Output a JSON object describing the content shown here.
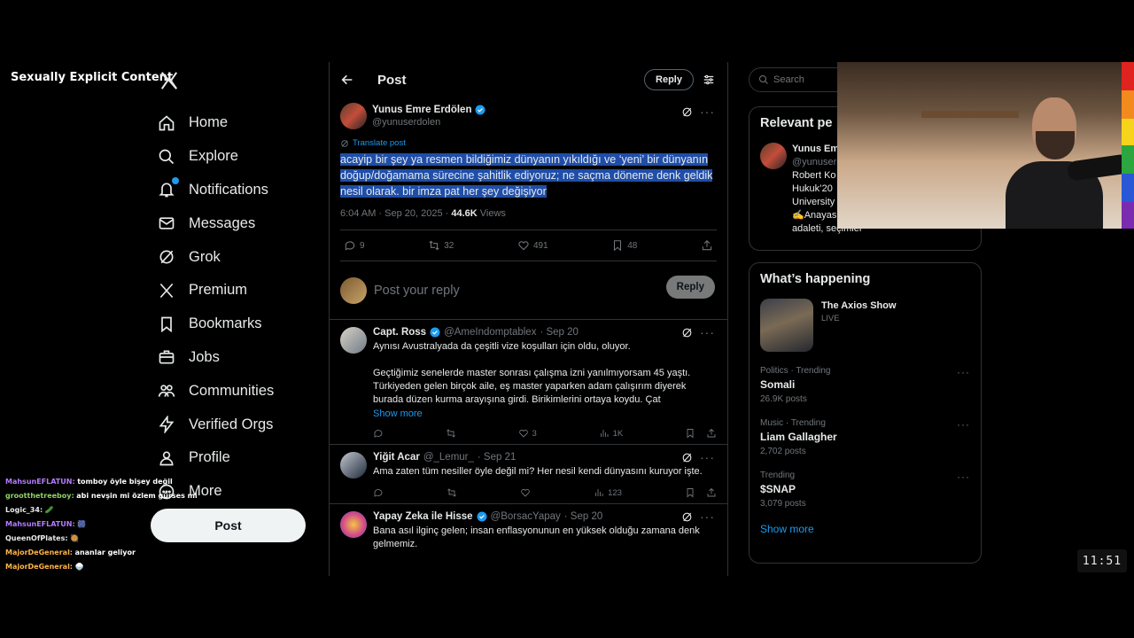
{
  "overlay": {
    "nsfw_label": "Sexually Explicit Content",
    "clock": "11:51"
  },
  "nav": {
    "items": [
      {
        "label": "Home",
        "icon": "home-icon"
      },
      {
        "label": "Explore",
        "icon": "search-icon"
      },
      {
        "label": "Notifications",
        "icon": "bell-icon"
      },
      {
        "label": "Messages",
        "icon": "mail-icon"
      },
      {
        "label": "Grok",
        "icon": "grok-icon"
      },
      {
        "label": "Premium",
        "icon": "x-icon"
      },
      {
        "label": "Bookmarks",
        "icon": "bookmark-icon"
      },
      {
        "label": "Jobs",
        "icon": "briefcase-icon"
      },
      {
        "label": "Communities",
        "icon": "people-icon"
      },
      {
        "label": "Verified Orgs",
        "icon": "lightning-icon"
      },
      {
        "label": "Profile",
        "icon": "person-icon"
      },
      {
        "label": "More",
        "icon": "more-circle-icon"
      }
    ],
    "post_button": "Post"
  },
  "chat": [
    {
      "user": "MahsunEFLATUN:",
      "text": "tomboy öyle bişey değil",
      "color": "#b57bff"
    },
    {
      "user": "grootthetreeboy:",
      "text": "abi nevşin mi özlem gürses mi",
      "color": "#8fd16a"
    },
    {
      "user": "Logic_34:",
      "text": "🥒",
      "color": "#e7e9ea"
    },
    {
      "user": "MahsunEFLATUN:",
      "text": "🎆",
      "color": "#b57bff"
    },
    {
      "user": "QueenOfPlates:",
      "text": "🥘",
      "color": "#e7e9ea"
    },
    {
      "user": "MajorDeGeneral:",
      "text": "ananlar geliyor",
      "color": "#ffb347"
    },
    {
      "user": "MajorDeGeneral:",
      "text": "🍚",
      "color": "#ffb347"
    }
  ],
  "header": {
    "title": "Post",
    "reply_label": "Reply"
  },
  "main_tweet": {
    "name": "Yunus Emre Erdölen",
    "handle": "@yunuserdolen",
    "translate": "Translate post",
    "text": "acayip bir şey ya resmen bildiğimiz dünyanın yıkıldığı ve ‘yeni’ bir dünyanın doğup/doğamama sürecine şahitlik ediyoruz; ne saçma döneme denk geldik nesil olarak. bir imza pat her şey değişiyor",
    "time": "6:04 AM · Sep 20, 2025 · ",
    "views_count": "44.6K",
    "views_label": " Views",
    "stats": {
      "replies": "9",
      "reposts": "32",
      "likes": "491",
      "bookmarks": "48"
    }
  },
  "compose": {
    "placeholder": "Post your reply",
    "button": "Reply"
  },
  "replies": [
    {
      "name": "Capt. Ross",
      "handle": "@AmeIndomptablex",
      "date": "· Sep 20",
      "verified": true,
      "text": "Aynısı Avustralyada da çeşitli vize koşulları için oldu, oluyor.",
      "text2": "Geçtiğimiz senelerde master sonrası çalışma izni yanılmıyorsam 45 yaştı. Türkiyeden gelen birçok aile, eş master yaparken adam çalışırım diyerek burada düzen kurma arayışına girdi. Birikimlerini ortaya koydu. Çat",
      "show_more": "Show more",
      "stats": {
        "replies": "",
        "reposts": "",
        "likes": "3",
        "views": "1K"
      }
    },
    {
      "name": "Yiğit Acar",
      "handle": "@_Lemur_",
      "date": "· Sep 21",
      "verified": false,
      "text": "Ama zaten tüm nesiller öyle değil mi? Her nesil kendi dünyasını kuruyor işte.",
      "stats": {
        "replies": "",
        "reposts": "",
        "likes": "",
        "views": "123"
      }
    },
    {
      "name": "Yapay Zeka ile Hisse",
      "handle": "@BorsacYapay",
      "date": "· Sep 20",
      "verified": true,
      "text": "Bana asıl ilginç gelen; insan enflasyonunun en yüksek olduğu zamana denk gelmemiz."
    }
  ],
  "right": {
    "search_placeholder": "Search",
    "relevant_title": "Relevant pe",
    "relevant_user": {
      "name": "Yunus Em",
      "handle": "@yunuser",
      "bio_lines": [
        "Robert Ko",
        "Hukuk’20",
        "University",
        "✍️Anayas",
        "adaleti, seçimler"
      ]
    },
    "happening_title": "What’s happening",
    "live": {
      "title": "The Axios Show",
      "badge": "LIVE"
    },
    "trends": [
      {
        "category": "Politics · Trending",
        "name": "Somali",
        "count": "26.9K posts"
      },
      {
        "category": "Music · Trending",
        "name": "Liam Gallagher",
        "count": "2,702 posts"
      },
      {
        "category": "Trending",
        "name": "$SNAP",
        "count": "3,079 posts"
      }
    ],
    "show_more": "Show more"
  }
}
